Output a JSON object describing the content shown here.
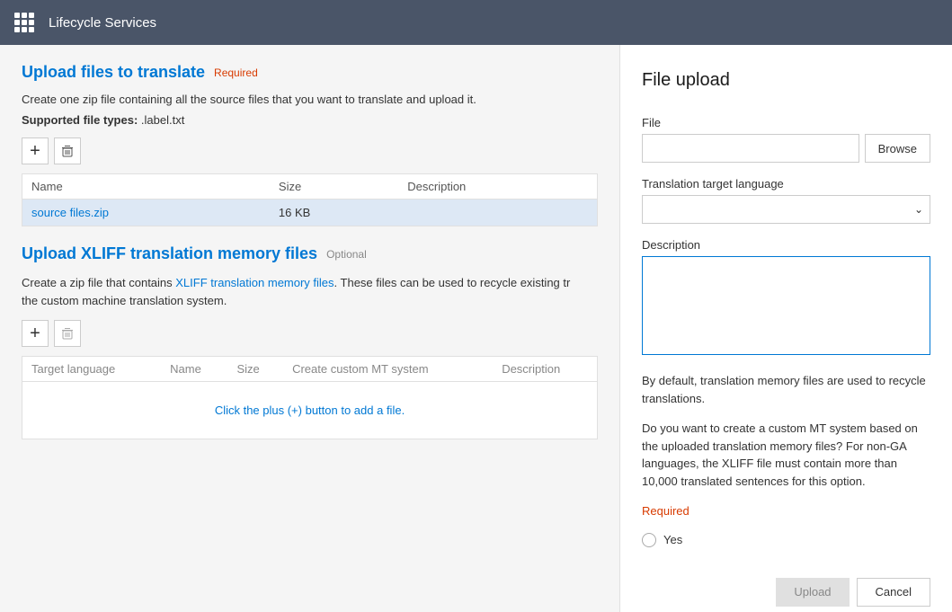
{
  "nav": {
    "title": "Lifecycle Services",
    "grid_icon_label": "App menu"
  },
  "left": {
    "section1": {
      "title": "Upload files to translate",
      "required_label": "Required",
      "description": "Create one zip file containing all the source files that you want to translate and upload it.",
      "supported_label": "Supported file types:",
      "supported_value": ".label.txt",
      "add_icon": "+",
      "delete_icon": "🗑",
      "table": {
        "columns": [
          "Name",
          "Size",
          "Description"
        ],
        "rows": [
          {
            "name": "source files.zip",
            "size": "16 KB",
            "description": ""
          }
        ]
      }
    },
    "section2": {
      "title": "Upload XLIFF translation memory files",
      "optional_label": "Optional",
      "description_parts": [
        "Create a zip file that contains XLIFF translation memory files. These files can be used to recycle existing tr",
        "the custom machine translation system."
      ],
      "add_icon": "+",
      "delete_icon": "🗑",
      "table": {
        "columns": [
          "Target language",
          "Name",
          "Size",
          "Create custom MT system",
          "Description"
        ],
        "empty_text": "Click the plus (+) button to add a file."
      }
    }
  },
  "right": {
    "panel_title": "File upload",
    "file_label": "File",
    "file_placeholder": "",
    "browse_label": "Browse",
    "translation_lang_label": "Translation target language",
    "description_label": "Description",
    "info_text1": "By default, translation memory files are used to recycle translations.",
    "info_text2": "Do you want to create a custom MT system based on the uploaded translation memory files? For non-GA languages, the XLIFF file must contain more than 10,000 translated sentences for this option.",
    "required_text": "Required",
    "yes_label": "Yes",
    "upload_label": "Upload",
    "cancel_label": "Cancel"
  }
}
